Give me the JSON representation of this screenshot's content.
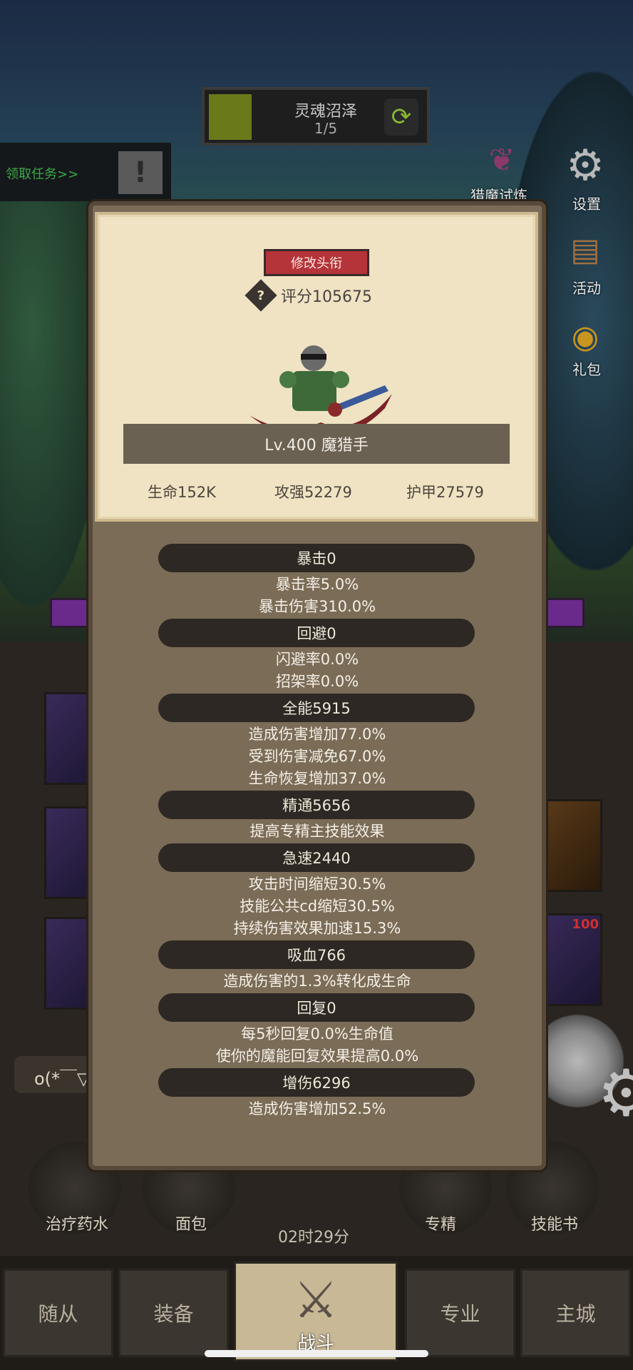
{
  "zone": {
    "name": "灵魂沼泽",
    "progress": "1/5",
    "refresh_icon": "refresh-icon"
  },
  "quest": {
    "label": "领取任务>>",
    "icon": "exclamation-icon"
  },
  "side_menu": [
    {
      "label": "猎魔试炼",
      "icon": "demon-wing-icon"
    },
    {
      "label": "设置",
      "icon": "gear-icon"
    },
    {
      "label": "活动",
      "icon": "scroll-icon"
    },
    {
      "label": "礼包",
      "icon": "gift-icon"
    }
  ],
  "panel": {
    "title_button": "修改头衔",
    "score": "评分105675",
    "level_name": "Lv.400 魔猎手",
    "stats": {
      "hp": "生命152K",
      "attack": "攻强52279",
      "armor": "护甲27579"
    },
    "sections": [
      {
        "header": "暴击0",
        "lines": [
          "暴击率5.0%",
          "暴击伤害310.0%"
        ]
      },
      {
        "header": "回避0",
        "lines": [
          "闪避率0.0%",
          "招架率0.0%"
        ]
      },
      {
        "header": "全能5915",
        "lines": [
          "造成伤害增加77.0%",
          "受到伤害减免67.0%",
          "生命恢复增加37.0%"
        ]
      },
      {
        "header": "精通5656",
        "lines": [
          "提高专精主技能效果"
        ]
      },
      {
        "header": "急速2440",
        "lines": [
          "攻击时间缩短30.5%",
          "技能公共cd缩短30.5%",
          "持续伤害效果加速15.3%"
        ]
      },
      {
        "header": "吸血766",
        "lines": [
          "造成伤害的1.3%转化成生命"
        ]
      },
      {
        "header": "回复0",
        "lines": [
          "每5秒回复0.0%生命值",
          "使你的魔能回复效果提高0.0%"
        ]
      },
      {
        "header": "增伤6296",
        "lines": [
          "造成伤害增加52.5%"
        ]
      }
    ]
  },
  "chat_text": "o(*￣▽",
  "slot_badge": "100",
  "bottom_items": [
    {
      "label": "治疗药水"
    },
    {
      "label": "面包"
    },
    {
      "label": "专精"
    },
    {
      "label": "技能书"
    }
  ],
  "timer": "02时29分",
  "nav": [
    {
      "label": "随从",
      "active": false
    },
    {
      "label": "装备",
      "active": false
    },
    {
      "label": "战斗",
      "active": true
    },
    {
      "label": "专业",
      "active": false
    },
    {
      "label": "主城",
      "active": false
    }
  ]
}
